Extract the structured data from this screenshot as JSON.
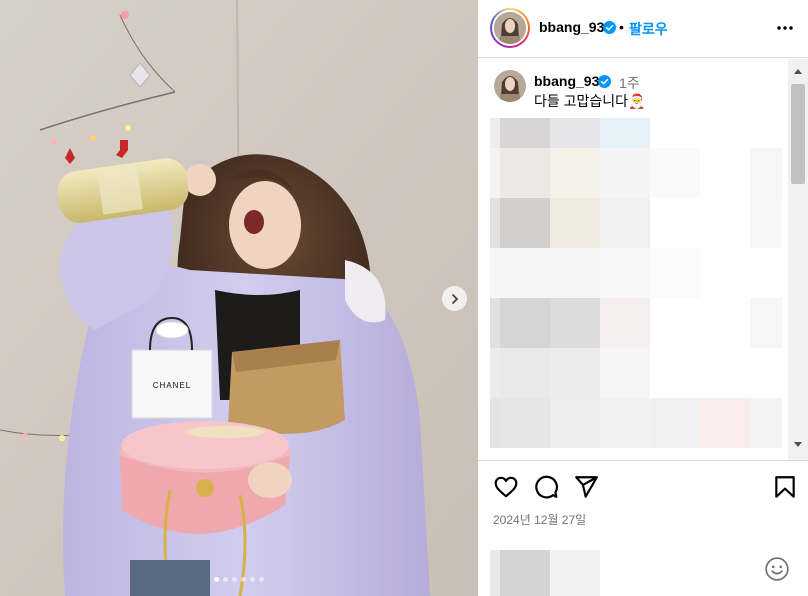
{
  "post": {
    "username": "bbang_93",
    "follow_label": "팔로우",
    "separator": "•",
    "caption_username": "bbang_93",
    "caption_time": "1주",
    "caption_text": "다들 고맙습니다",
    "caption_emoji": "🎅",
    "date": "2024년 12월 27일",
    "photo_count": 6,
    "active_photo": 1
  },
  "photo": {
    "bag_brand": "CHANEL"
  },
  "icons": {
    "verified": "verified-badge-icon",
    "more": "more-options-icon",
    "like": "heart-icon",
    "comment": "comment-icon",
    "share": "share-icon",
    "save": "bookmark-icon",
    "emoji": "emoji-icon",
    "next": "chevron-right-icon"
  },
  "colors": {
    "accent": "#0095f6",
    "border": "#dbdbdb",
    "muted": "#737373",
    "jacket": "#c9c3e6",
    "hatbox": "#f1b9bd"
  }
}
